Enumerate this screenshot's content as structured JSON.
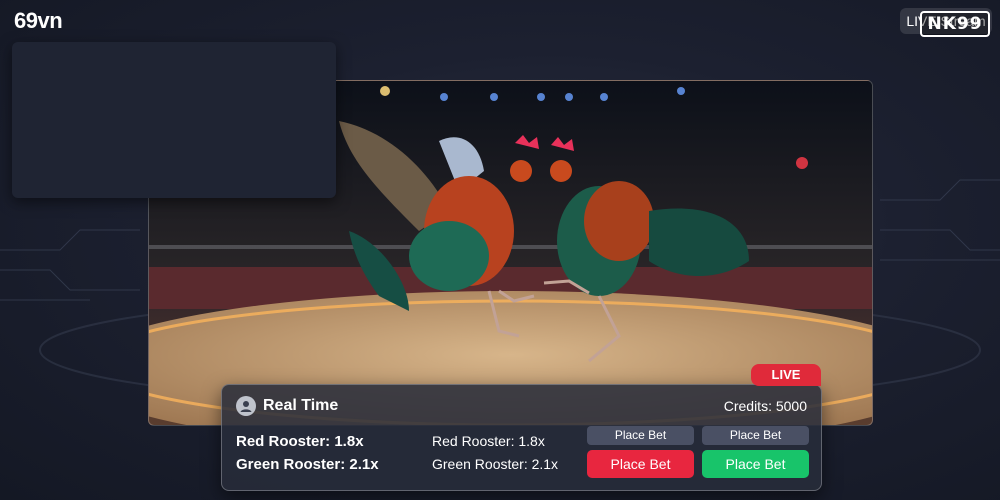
{
  "header": {
    "brand": "69vn",
    "live_stream_label": "LIVE Stream",
    "watermark": "NK99"
  },
  "stream": {
    "badge": "LIVE"
  },
  "panel": {
    "title": "Real Time",
    "credits": "Credits: 5000",
    "odds_primary": [
      "Red Rooster: 1.8x",
      "Green Rooster: 2.1x"
    ],
    "odds_secondary": [
      "Red Rooster: 1.8x",
      "Green Rooster: 2.1x"
    ],
    "small_buttons": [
      "Place Bet",
      "Place Bet"
    ],
    "bet_red_label": "Place Bet",
    "bet_green_label": "Place Bet"
  },
  "colors": {
    "accent_red": "#e8263f",
    "accent_green": "#18c46a",
    "live_badge": "#e02a3a"
  }
}
